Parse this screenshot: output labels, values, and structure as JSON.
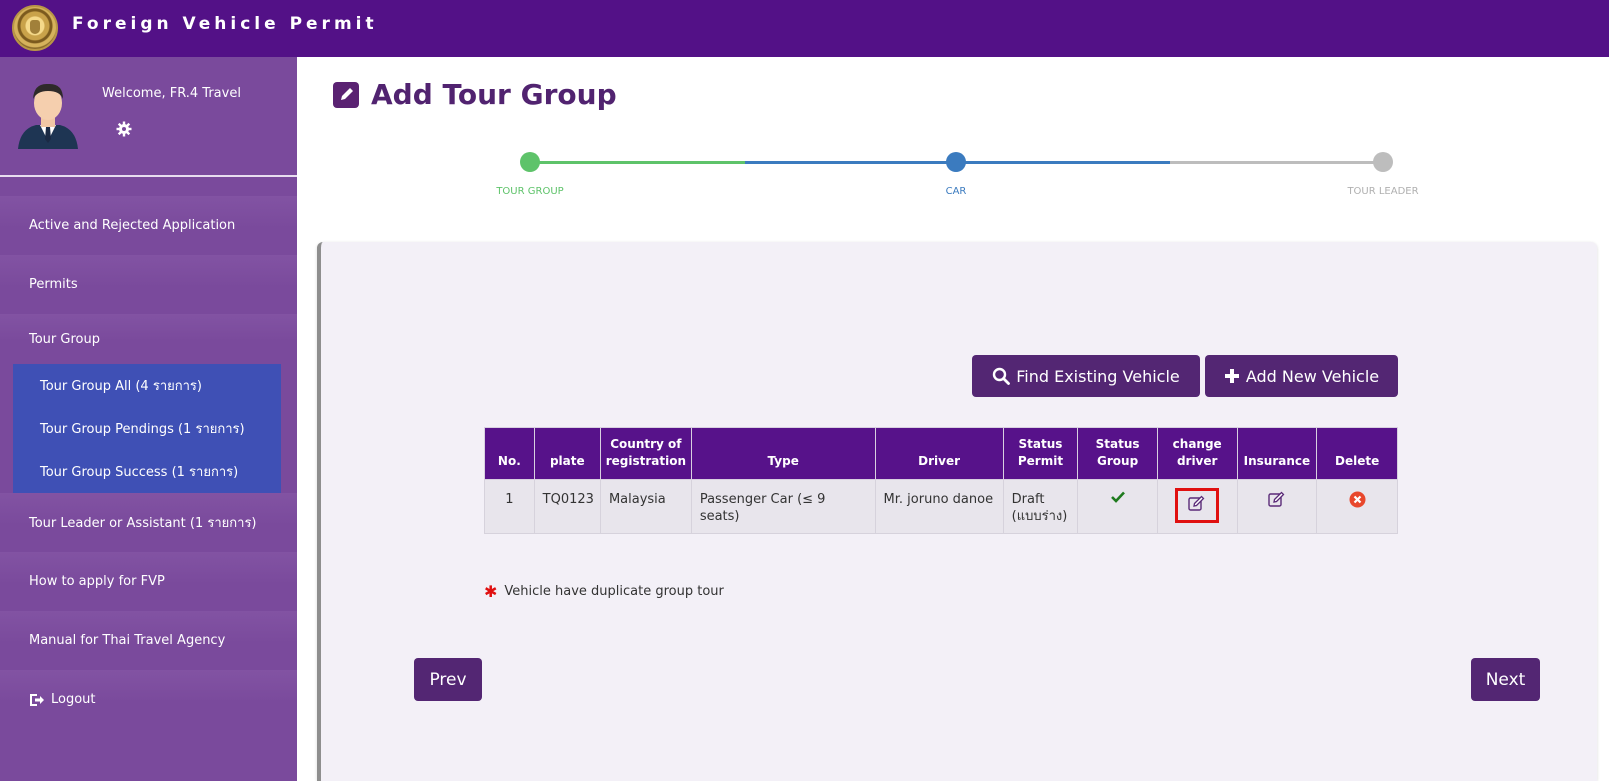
{
  "header": {
    "app_title": "Foreign Vehicle Permit"
  },
  "profile": {
    "welcome": "Welcome, FR.4 Travel"
  },
  "sidebar": {
    "items": [
      {
        "label": "Active and Rejected Application"
      },
      {
        "label": "Permits"
      },
      {
        "label": "Tour Group"
      },
      {
        "label": "Tour Leader or Assistant (1 รายการ)"
      },
      {
        "label": "How to apply for FVP"
      },
      {
        "label": "Manual for Thai Travel Agency"
      },
      {
        "label": "Logout"
      }
    ],
    "tour_group_sub": [
      {
        "label": "Tour Group All (4 รายการ)"
      },
      {
        "label": "Tour Group Pendings (1 รายการ)"
      },
      {
        "label": "Tour Group Success (1 รายการ)"
      }
    ]
  },
  "page": {
    "title": "Add Tour Group"
  },
  "stepper": {
    "steps": [
      {
        "label": "TOUR GROUP",
        "state": "done",
        "color": "#5ec36a"
      },
      {
        "label": "CAR",
        "state": "current",
        "color": "#3b7bbf"
      },
      {
        "label": "TOUR LEADER",
        "state": "pending",
        "color": "#bdbdbd"
      }
    ]
  },
  "actions": {
    "find_existing": "Find Existing Vehicle",
    "add_new": "Add New Vehicle"
  },
  "table": {
    "headers": {
      "no": "No.",
      "plate": "plate",
      "country_line1": "Country of",
      "country_line2": "registration",
      "type": "Type",
      "driver": "Driver",
      "status_permit_line1": "Status",
      "status_permit_line2": "Permit",
      "status_group_line1": "Status",
      "status_group_line2": "Group",
      "change_driver_line1": "change",
      "change_driver_line2": "driver",
      "insurance": "Insurance",
      "delete": "Delete"
    },
    "rows": [
      {
        "no": "1",
        "plate": "TQ0123",
        "country": "Malaysia",
        "type": "Passenger Car (≤ 9 seats)",
        "driver": "Mr. joruno danoe",
        "status_permit_line1": "Draft",
        "status_permit_line2": "(แบบร่าง)",
        "status_group": "check-icon"
      }
    ]
  },
  "note": {
    "text": "Vehicle have duplicate group tour"
  },
  "nav_buttons": {
    "prev": "Prev",
    "next": "Next"
  },
  "colors": {
    "topbar": "#531187",
    "sidebar": "#7a4a9c",
    "submenu": "#3f50b5",
    "button": "#532673",
    "table_header": "#57128a",
    "highlight": "#e01010"
  }
}
